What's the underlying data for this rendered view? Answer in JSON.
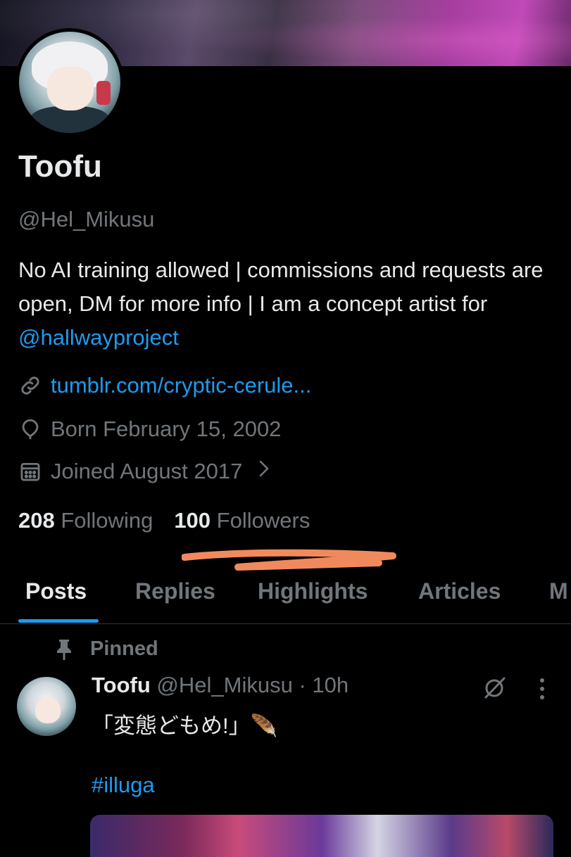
{
  "profile": {
    "name": "Toofu",
    "handle": "@Hel_Mikusu",
    "bio_text": "No AI training allowed |  commissions and requests are open, DM for more info |  I am a concept artist for ",
    "bio_mention": "@hallwayproject",
    "website": "tumblr.com/cryptic-cerule...",
    "birthday": "Born February 15, 2002",
    "joined": "Joined August 2017",
    "following_count": "208",
    "following_label": "Following",
    "followers_count": "100",
    "followers_label": "Followers"
  },
  "tabs": [
    {
      "label": "Posts",
      "active": true
    },
    {
      "label": "Replies",
      "active": false
    },
    {
      "label": "Highlights",
      "active": false
    },
    {
      "label": "Articles",
      "active": false
    },
    {
      "label": "M",
      "active": false
    }
  ],
  "pinned_post": {
    "pinned_label": "Pinned",
    "author_name": "Toofu",
    "author_handle": "@Hel_Mikusu",
    "separator": " · ",
    "time": "10h",
    "text": "「変態どもめ!」🪶",
    "hashtag": "#illuga"
  },
  "colors": {
    "background": "#000000",
    "text_primary": "#e7e9ea",
    "text_secondary": "#71767b",
    "accent_link": "#1d9bf0",
    "divider": "#2f3336",
    "scribble": "#f08a5d"
  },
  "icons": [
    "link-icon",
    "location-icon",
    "calendar-icon",
    "chevron-right-icon",
    "pin-icon",
    "grok-icon",
    "more-icon"
  ]
}
